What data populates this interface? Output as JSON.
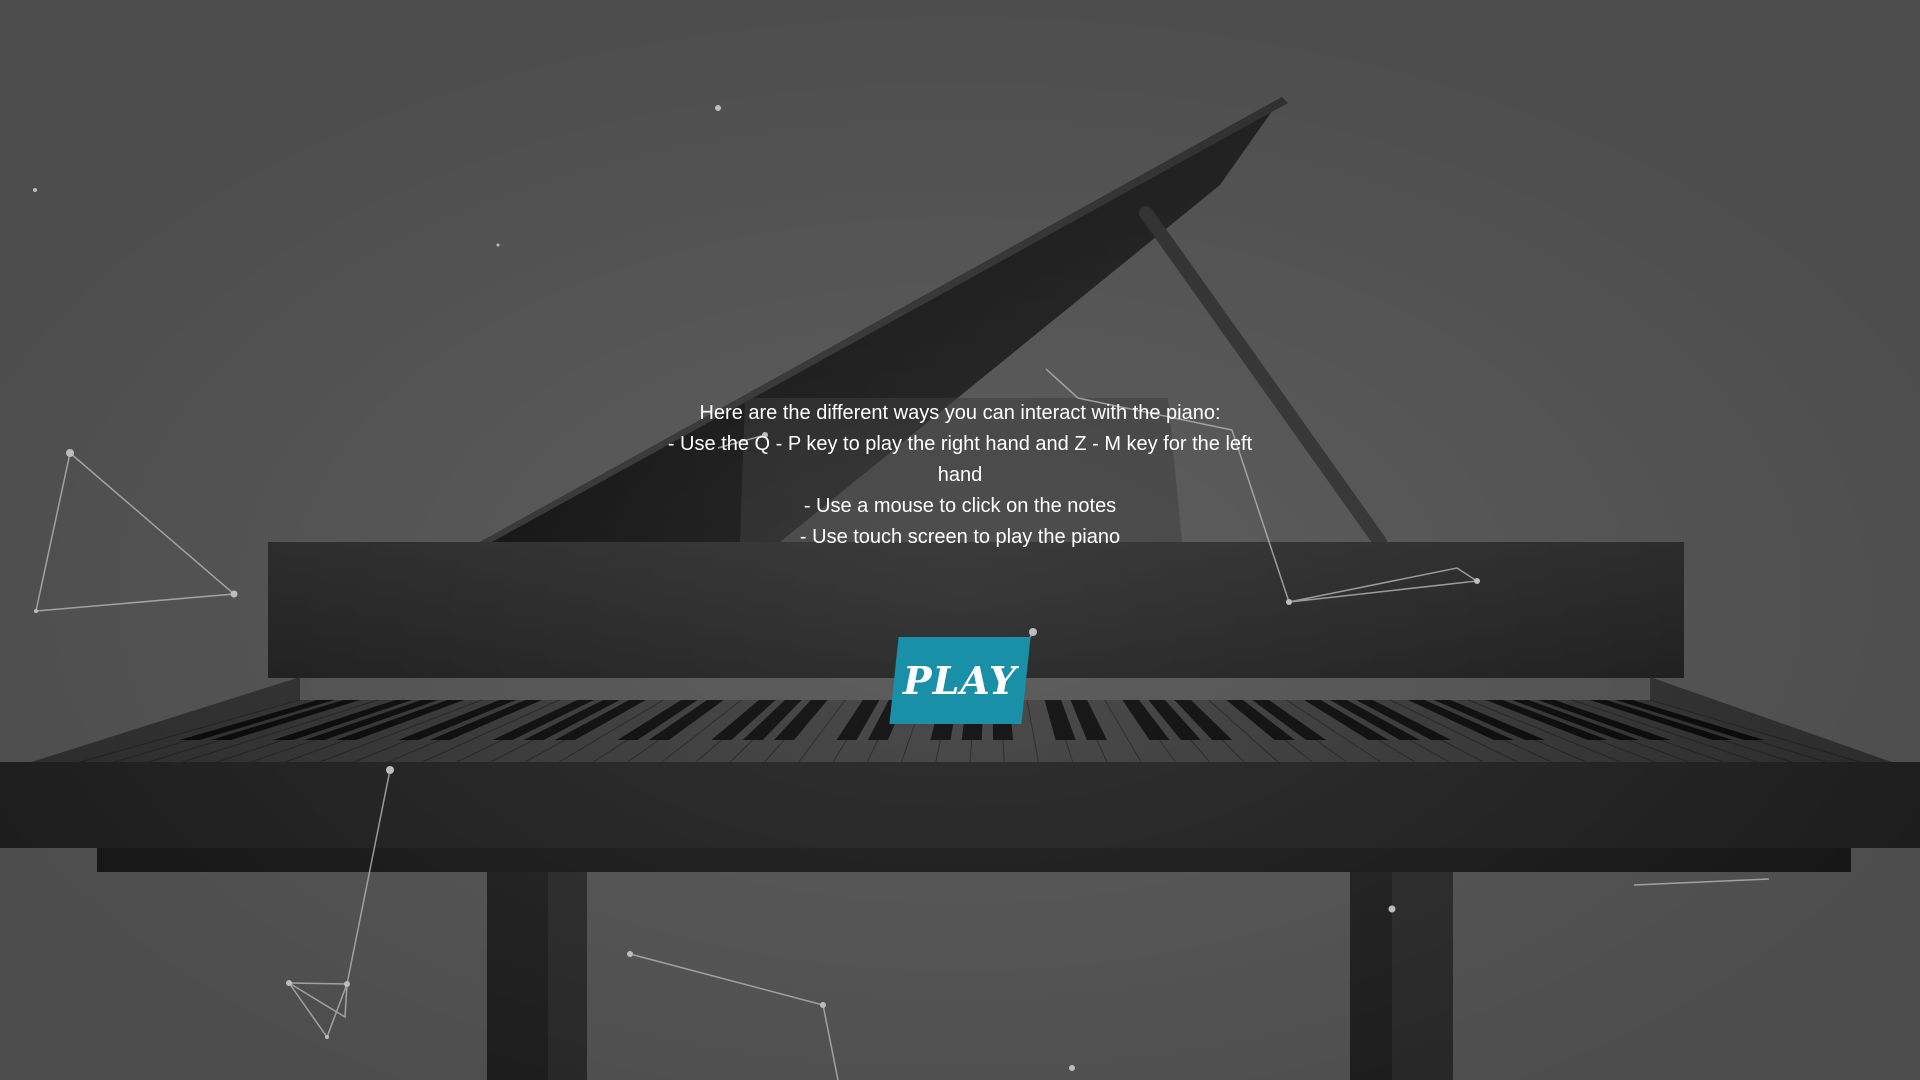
{
  "instructions": {
    "heading": "Here are the different ways you can interact with the piano:",
    "line1": "- Use the Q - P key to play the right hand and Z - M key for the left hand",
    "line2": "- Use a mouse to click on the notes",
    "line3": "- Use touch screen to play the piano"
  },
  "play_button": {
    "label": "PLAY",
    "color": "#1a8fa8"
  },
  "colors": {
    "background": "#4d4d4d",
    "piano_body": "#1c1c1c",
    "particle": "#bdbdbd"
  }
}
